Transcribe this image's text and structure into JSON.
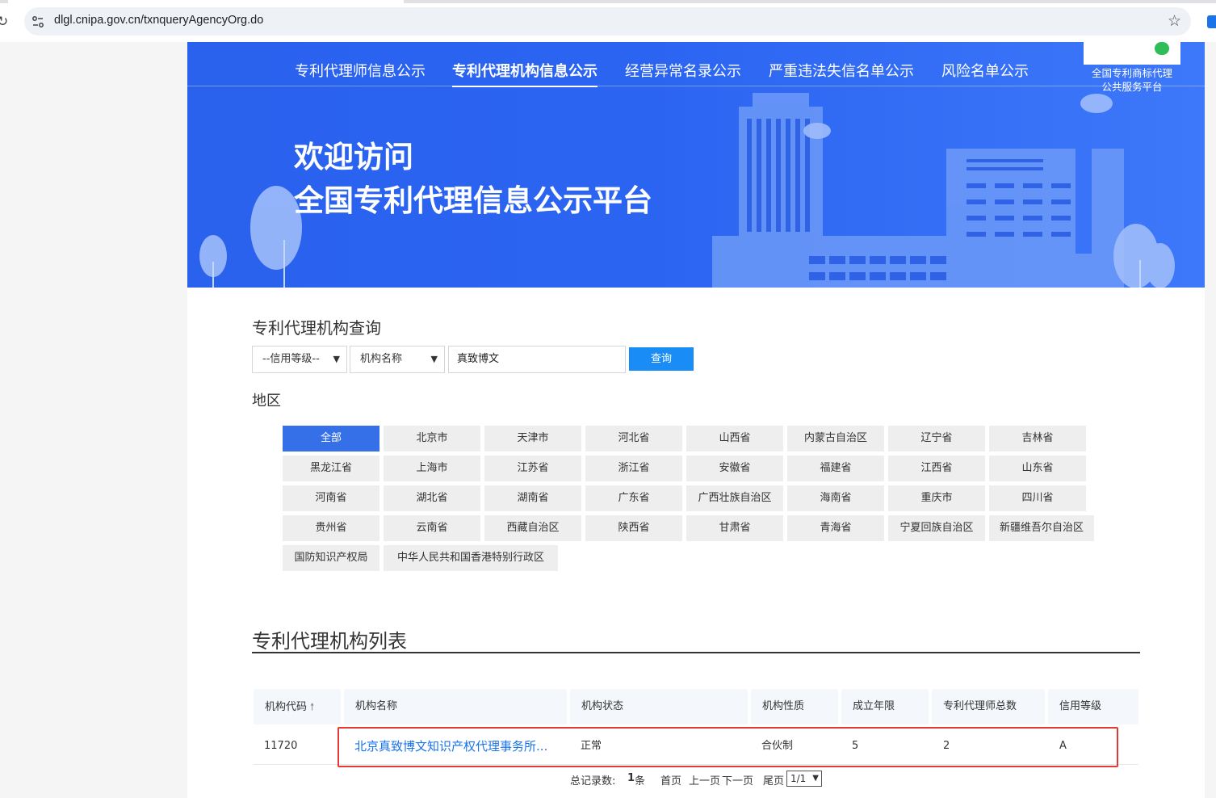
{
  "browser": {
    "url": "dlgl.cnipa.gov.cn/txnqueryAgencyOrg.do"
  },
  "nav": {
    "items": [
      {
        "label": "专利代理师信息公示"
      },
      {
        "label": "专利代理机构信息公示"
      },
      {
        "label": "经营异常名录公示"
      },
      {
        "label": "严重违法失信名单公示"
      },
      {
        "label": "风险名单公示"
      }
    ],
    "active_index": 1
  },
  "qr": {
    "caption_line1": "全国专利商标代理",
    "caption_line2": "公共服务平台"
  },
  "banner": {
    "welcome_line1": "欢迎访问",
    "welcome_line2": "全国专利代理信息公示平台"
  },
  "search": {
    "title": "专利代理机构查询",
    "credit_select": "--信用等级--",
    "field_select": "机构名称",
    "input_value": "真致博文",
    "button_label": "查询"
  },
  "regions": {
    "title": "地区",
    "items": [
      "全部",
      "北京市",
      "天津市",
      "河北省",
      "山西省",
      "内蒙古自治区",
      "辽宁省",
      "吉林省",
      "黑龙江省",
      "上海市",
      "江苏省",
      "浙江省",
      "安徽省",
      "福建省",
      "江西省",
      "山东省",
      "河南省",
      "湖北省",
      "湖南省",
      "广东省",
      "广西壮族自治区",
      "海南省",
      "重庆市",
      "四川省",
      "贵州省",
      "云南省",
      "西藏自治区",
      "陕西省",
      "甘肃省",
      "青海省",
      "宁夏回族自治区",
      "新疆维吾尔自治区",
      "国防知识产权局",
      "中华人民共和国香港特别行政区"
    ],
    "active": "全部"
  },
  "list": {
    "title": "专利代理机构列表",
    "columns": [
      "机构代码",
      "机构名称",
      "机构状态",
      "机构性质",
      "成立年限",
      "专利代理师总数",
      "信用等级"
    ],
    "rows": [
      {
        "code": "11720",
        "name": "北京真致博文知识产权代理事务所...",
        "status": "正常",
        "nature": "合伙制",
        "years": "5",
        "agents": "2",
        "credit": "A"
      }
    ]
  },
  "pager": {
    "total_label": "总记录数:",
    "total_count": "1",
    "unit": "条",
    "first": "首页",
    "prev": "上一页",
    "next": "下一页",
    "last": "尾页",
    "page_select": "1/1"
  }
}
